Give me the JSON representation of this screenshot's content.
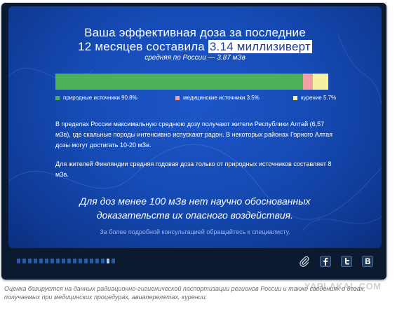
{
  "title": {
    "line1": "Ваша эффективная доза за последние",
    "line2_prefix": "12 месяцев составила",
    "line2_value": "3.14 миллизиверт"
  },
  "subtitle": "средняя по России — 3.87 мЗв",
  "chart_data": {
    "type": "bar",
    "stacked": true,
    "series": [
      {
        "name": "природные источники 90.8%",
        "value": 90.8,
        "color": "#4db05b"
      },
      {
        "name": "медицинские источники 3.5%",
        "value": 3.5,
        "color": "#f2a1a5"
      },
      {
        "name": "курение 5.7%",
        "value": 5.7,
        "color": "#f6f1a1"
      }
    ]
  },
  "paragraphs": [
    "В пределах России максимальную среднюю дозу получают жители Республики Алтай (6,57 мЗв), где скальные породы интенсивно испускают радон. В некоторых районах Горного Алтая дозы могут достигать 10-20 мЗв.",
    "Для жителей Финляндии средняя годовая доза только от природных источников составляет 8 мЗв."
  ],
  "claim": {
    "line1": "Для доз менее 100 мЗв нет научно обоснованных",
    "line2": "доказательств их опасного воздействия."
  },
  "consult": "За более подробной консультацией обращайтесь к специалисту.",
  "pagination": {
    "total": 18,
    "active": 17
  },
  "social": [
    {
      "icon": "paperclip-icon"
    },
    {
      "icon": "facebook-icon"
    },
    {
      "icon": "twitter-icon"
    },
    {
      "icon": "vk-icon"
    }
  ],
  "footnote": "Оценка базируется на данных радиационно-гигиенической паспортизации регионов России и также сведениях о дозах, получаемых при медицинских процедурах, авиаперелетах, курении.",
  "watermark": "YAPLAKAL.COM",
  "colors": {
    "panel": "#164bb5",
    "frame": "#0b1a2f",
    "highlight_text": "#1a3f99"
  }
}
